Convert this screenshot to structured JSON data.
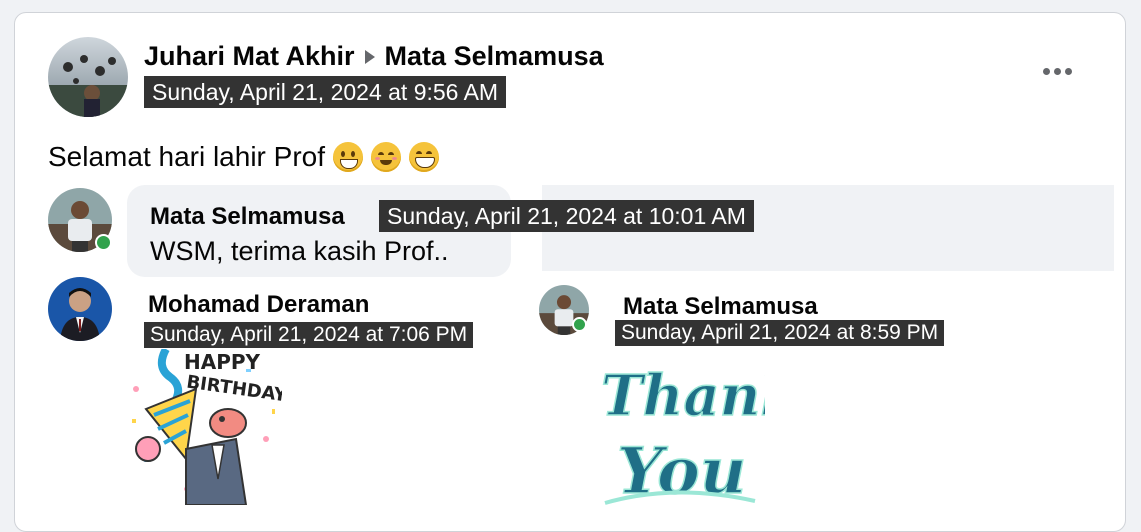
{
  "post": {
    "author": "Juhari Mat Akhir",
    "target": "Mata Selmamusa",
    "timestamp": "Sunday, April 21, 2024 at 9:56 AM",
    "text": "Selamat hari lahir Prof",
    "emojis": [
      "grinning-face-icon",
      "smiling-face-icon",
      "beaming-face-icon"
    ]
  },
  "comments": [
    {
      "author": "Mata Selmamusa",
      "timestamp": "Sunday, April 21, 2024 at 10:01 AM",
      "text": "WSM, terima kasih Prof.."
    },
    {
      "author": "Mohamad Deraman",
      "timestamp": "Sunday, April 21, 2024 at 7:06 PM",
      "sticker": {
        "line1": "HAPPY",
        "line2": "BIRTHDAY"
      }
    },
    {
      "author": "Mata Selmamusa",
      "timestamp": "Sunday, April 21, 2024 at 8:59 PM",
      "sticker": {
        "line1": "Thank",
        "line2": "You"
      }
    }
  ],
  "colors": {
    "online": "#31a24c",
    "bubble": "#f0f2f5",
    "timestamp_bg": "#333333",
    "thank_you": "#1f6f87"
  }
}
